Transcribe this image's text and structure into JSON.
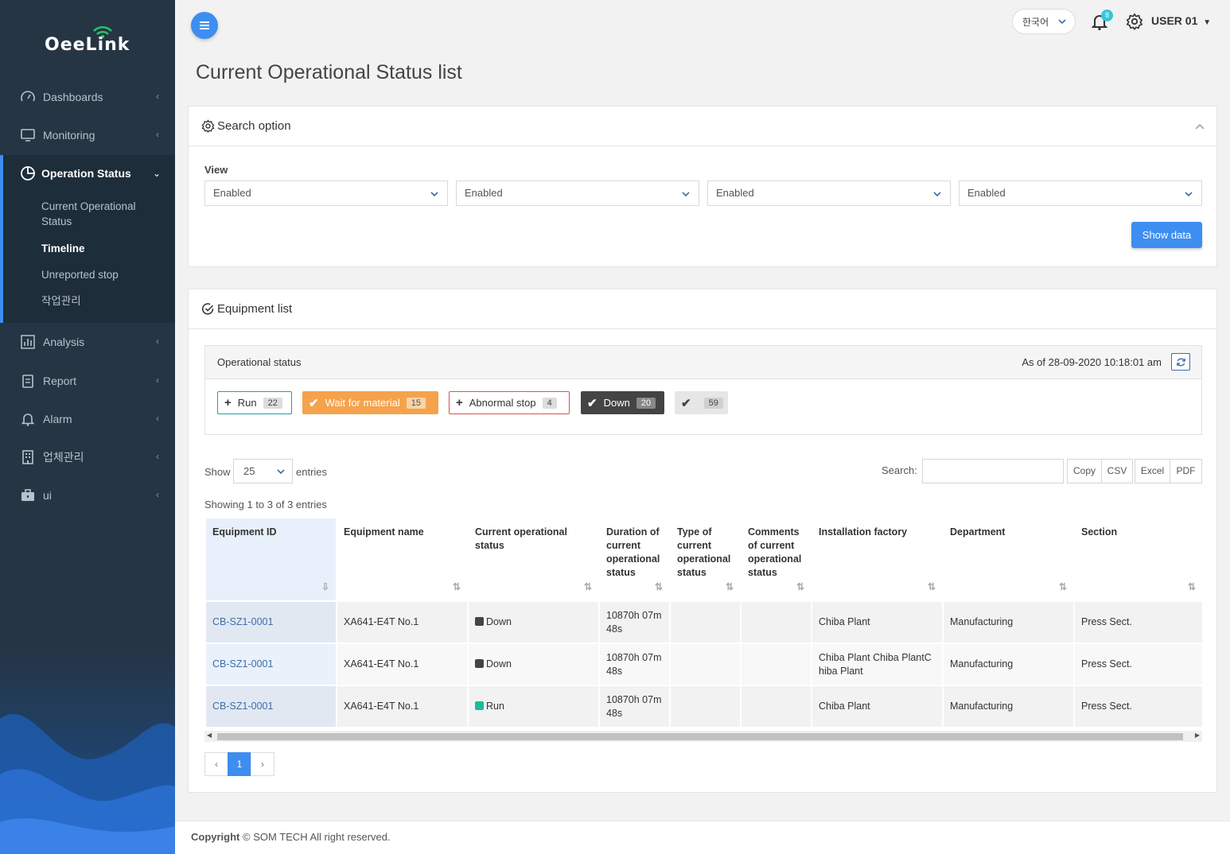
{
  "brand": {
    "name": "OeeLink"
  },
  "sidebar": {
    "items": [
      {
        "label": "Dashboards",
        "icon": "gauge-icon"
      },
      {
        "label": "Monitoring",
        "icon": "monitor-icon"
      },
      {
        "label": "Analysis",
        "icon": "bar-chart-icon"
      },
      {
        "label": "Report",
        "icon": "clipboard-icon"
      },
      {
        "label": "Alarm",
        "icon": "bell-icon"
      },
      {
        "label": "업체관리",
        "icon": "building-icon"
      },
      {
        "label": "ui",
        "icon": "briefcase-icon"
      }
    ],
    "group": {
      "label": "Operation Status",
      "icon": "pie-chart-icon",
      "children": [
        {
          "label": "Current Operational Status"
        },
        {
          "label": "Timeline"
        },
        {
          "label": "Unreported stop"
        },
        {
          "label": "작업관리"
        }
      ]
    }
  },
  "topbar": {
    "language": "한국어",
    "notifications": "8",
    "user": "USER 01"
  },
  "page": {
    "title": "Current Operational Status list"
  },
  "search_panel": {
    "title": "Search option",
    "view_label": "View",
    "selects": [
      "Enabled",
      "Enabled",
      "Enabled",
      "Enabled"
    ],
    "show_button": "Show data"
  },
  "equipment_panel": {
    "title": "Equipment list",
    "status_box": {
      "title": "Operational status",
      "as_of": "As of 28-09-2020 10:18:01 am",
      "chips": [
        {
          "label": "Run",
          "count": "22",
          "icon": "plus-icon"
        },
        {
          "label": "Wait for material",
          "count": "15",
          "icon": "check-icon"
        },
        {
          "label": "Abnormal stop",
          "count": "4",
          "icon": "plus-icon"
        },
        {
          "label": "Down",
          "count": "20",
          "icon": "check-icon"
        },
        {
          "label": "",
          "count": "59",
          "icon": "check-icon"
        }
      ]
    },
    "controls": {
      "show": "Show",
      "length": "25",
      "entries": "entries",
      "search_label": "Search:",
      "info": "Showing 1 to 3 of 3 entries",
      "buttons": [
        "Copy",
        "CSV",
        "Excel",
        "PDF"
      ]
    },
    "table": {
      "columns": [
        "Equipment ID",
        "Equipment name",
        "Current operational status",
        "Duration of current operational status",
        "Type of current operational status",
        "Comments of current operational status",
        "Installation factory",
        "Department",
        "Section"
      ],
      "rows": [
        {
          "id": "CB-SZ1-0001",
          "name": "XA641-E4T No.1",
          "status": "Down",
          "duration": "10870h 07m 48s",
          "type": "",
          "comments": "",
          "factory": "Chiba Plant",
          "dept": "Manufacturing",
          "section": "Press Sect."
        },
        {
          "id": "CB-SZ1-0001",
          "name": "XA641-E4T No.1",
          "status": "Down",
          "duration": "10870h 07m 48s",
          "type": "",
          "comments": "",
          "factory": "Chiba Plant Chiba PlantChiba Plant",
          "dept": "Manufacturing",
          "section": "Press Sect."
        },
        {
          "id": "CB-SZ1-0001",
          "name": "XA641-E4T No.1",
          "status": "Run",
          "duration": "10870h 07m 48s",
          "type": "",
          "comments": "",
          "factory": "Chiba Plant",
          "dept": "Manufacturing",
          "section": "Press Sect."
        }
      ]
    },
    "pagination": {
      "prev": "‹",
      "current": "1",
      "next": "›"
    }
  },
  "footer": {
    "bold": "Copyright",
    "text": "© SOM TECH All right reserved."
  },
  "colors": {
    "accent": "#3d8ef0",
    "sidebar": "#253544",
    "run": "#1abc9c",
    "wait": "#f5a24b",
    "abnormal": "#d9534f",
    "down": "#444444"
  }
}
